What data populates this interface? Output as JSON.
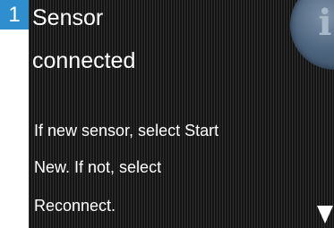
{
  "step": {
    "number": "1",
    "badge_color": "#2f8fce"
  },
  "title": {
    "line1": "Sensor",
    "line2": "connected"
  },
  "message": {
    "line1": "If new sensor, select Start",
    "line2": "New. If not, select",
    "line3": "Reconnect."
  },
  "icons": {
    "info": "info-icon",
    "scroll": "scroll-down-arrow-icon"
  },
  "colors": {
    "screen_background": "#1b1b1b",
    "text": "#ffffff",
    "info_button": "#4f6680"
  }
}
